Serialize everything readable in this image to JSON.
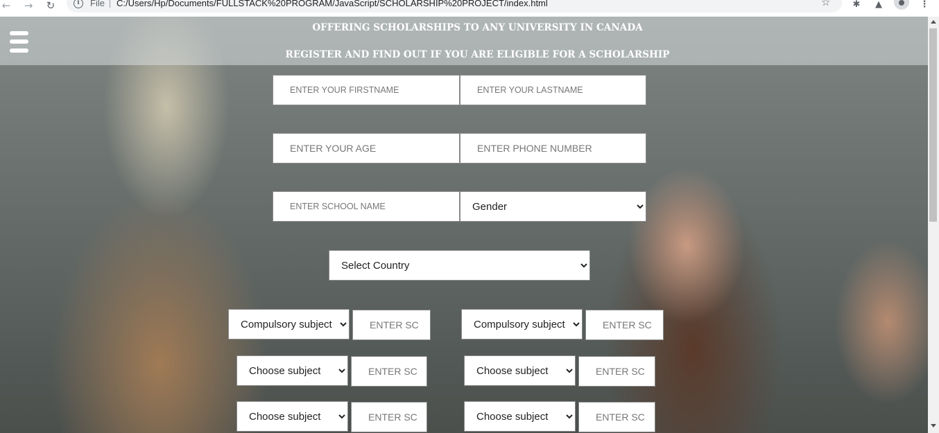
{
  "browser": {
    "scheme": "File",
    "url": "C:/Users/Hp/Documents/FULLSTACK%20PROGRAM/JavaScript/SCHOLARSHIP%20PROJECT/index.html"
  },
  "header": {
    "headline": "OFFERING SCHOLARSHIPS TO ANY UNIVERSITY IN CANADA",
    "subheadline": "REGISTER AND FIND OUT IF YOU ARE ELIGIBLE FOR A SCHOLARSHIP"
  },
  "form": {
    "firstname_placeholder": "ENTER YOUR FIRSTNAME",
    "lastname_placeholder": "ENTER YOUR LASTNAME",
    "age_placeholder": "ENTER YOUR AGE",
    "phone_placeholder": "ENTER PHONE NUMBER",
    "school_placeholder": "ENTER SCHOOL NAME",
    "gender_selected": "Gender",
    "country_selected": "Select Country"
  },
  "subjects": {
    "compulsory_label": "Compulsory subject",
    "choose_label": "Choose subject",
    "score_placeholder": "ENTER SC"
  }
}
